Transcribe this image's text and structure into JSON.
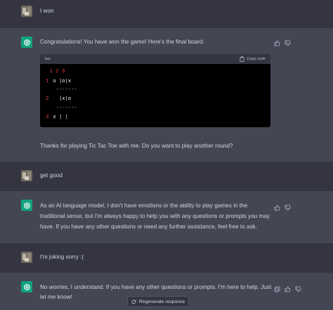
{
  "messages": [
    {
      "role": "user",
      "text": "I won"
    },
    {
      "role": "assistant",
      "text": "Congratulations! You have won the game! Here's the final board:"
    },
    {
      "role": "assistant",
      "text": "Thanks for playing Tic Tac Toe with me. Do you want to play another round?"
    },
    {
      "role": "user",
      "text": "get good"
    },
    {
      "role": "assistant",
      "line1": "As an AI language model, I don't have emotions or the ability to play games in the",
      "line2": "traditional sense, but I'm always happy to help you with any questions or prompts you may",
      "line3": "have. If you have any other questions or need any further assistance, feel free to ask."
    },
    {
      "role": "user",
      "text": "I'm joking sorry :("
    },
    {
      "role": "assistant",
      "line1": "No worries, I understand. If you have any other questions or prompts, I'm here to help. Just",
      "line2": "let me know!"
    }
  ],
  "code_block": {
    "language": "lua",
    "copy_label": "Copy code",
    "header_line": "  1 2 3",
    "rows": [
      {
        "num": "1",
        "content": " o |o|x"
      },
      {
        "num": "",
        "content": "  -------"
      },
      {
        "num": "2",
        "content": "   |x|o"
      },
      {
        "num": "",
        "content": "  -------"
      },
      {
        "num": "3",
        "content": " x | |"
      }
    ]
  },
  "regenerate_label": "Regenerate response",
  "colors": {
    "user_bg": "#343541",
    "assistant_bg": "#444654",
    "accent": "#10a37f",
    "code_number": "#ef4146"
  }
}
